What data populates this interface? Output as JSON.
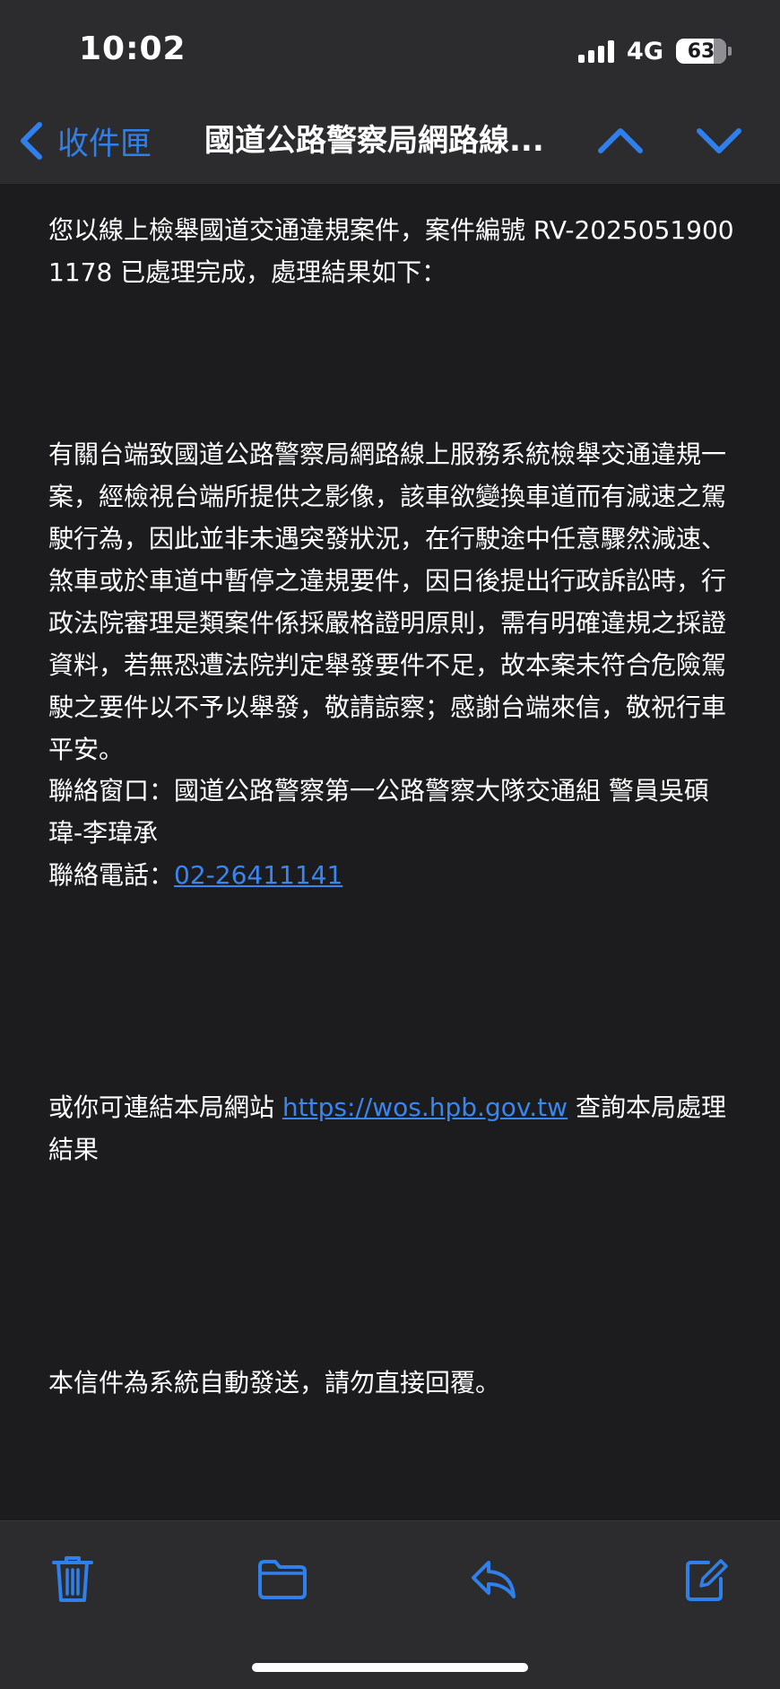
{
  "status_bar": {
    "time": "10:02",
    "network": "4G",
    "battery": "63"
  },
  "nav": {
    "back_label": "收件匣",
    "title": "國道公路警察局網路線...",
    "icons": [
      "chevron-left-icon",
      "chevron-up-icon",
      "chevron-down-icon"
    ]
  },
  "email": {
    "intro": "您以線上檢舉國道交通違規案件，案件編號 RV-20250519001178 已處理完成，處理結果如下：",
    "body": "有關台端致國道公路警察局網路線上服務系統檢舉交通違規一案，經檢視台端所提供之影像，該車欲變換車道而有減速之駕駛行為，因此並非未遇突發狀況，在行駛途中任意驟然減速、煞車或於車道中暫停之違規要件，因日後提出行政訴訟時，行政法院審理是類案件係採嚴格證明原則，需有明確違規之採證資料，若無恐遭法院判定舉發要件不足，故本案未符合危險駕駛之要件以不予以舉發，敬請諒察；感謝台端來信，敬祝行車平安。",
    "contact_window": "聯絡窗口：國道公路警察第一公路警察大隊交通組 警員吳碩瑋-李瑋承",
    "phone_label": "聯絡電話：",
    "phone": "02-26411141",
    "website_prefix": "或你可連結本局網站 ",
    "website_url": "https://wos.hpb.gov.tw",
    "website_suffix": " 查詢本局處理結果",
    "footer_note": "本信件為系統自動發送，請勿直接回覆。"
  },
  "toolbar": {
    "icons": [
      "trash-icon",
      "folder-icon",
      "reply-icon",
      "compose-icon"
    ]
  },
  "colors": {
    "accent": "#2f80ed",
    "background": "#1c1c1e",
    "bar": "#2c2c2e"
  }
}
